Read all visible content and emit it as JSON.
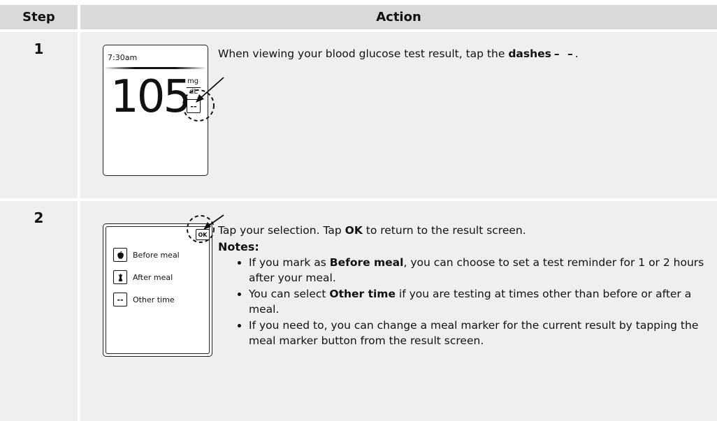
{
  "table": {
    "header_step": "Step",
    "header_action": "Action"
  },
  "row1": {
    "step": "1",
    "screen": {
      "time": "7:30am",
      "value": "105",
      "unit_top": "mg",
      "unit_bottom": "dL",
      "dash_button": "--"
    },
    "text_before": "When viewing your blood glucose test result, tap the ",
    "text_bold": "dashes",
    "text_dashes": "– –",
    "text_after": "."
  },
  "row2": {
    "step": "2",
    "screen": {
      "ok_label": "OK",
      "options": [
        {
          "label": "Before meal",
          "icon": "apple-icon"
        },
        {
          "label": "After meal",
          "icon": "apple-core-icon"
        },
        {
          "label": "Other time",
          "icon": "dashes-icon",
          "glyph": "--"
        }
      ]
    },
    "intro_1": "Tap your selection. Tap ",
    "intro_bold": "OK",
    "intro_2": " to return to the result screen.",
    "notes_title": "Notes:",
    "note1_a": "If you mark as ",
    "note1_b": "Before meal",
    "note1_c": ", you can choose to set a test reminder for 1 or 2 hours after your meal.",
    "note2_a": "You can select ",
    "note2_b": "Other time",
    "note2_c": " if you are testing at times other than before or after a meal.",
    "note3": "If you need to, you can change a meal marker for the current result by tapping the meal marker button from the result screen."
  }
}
